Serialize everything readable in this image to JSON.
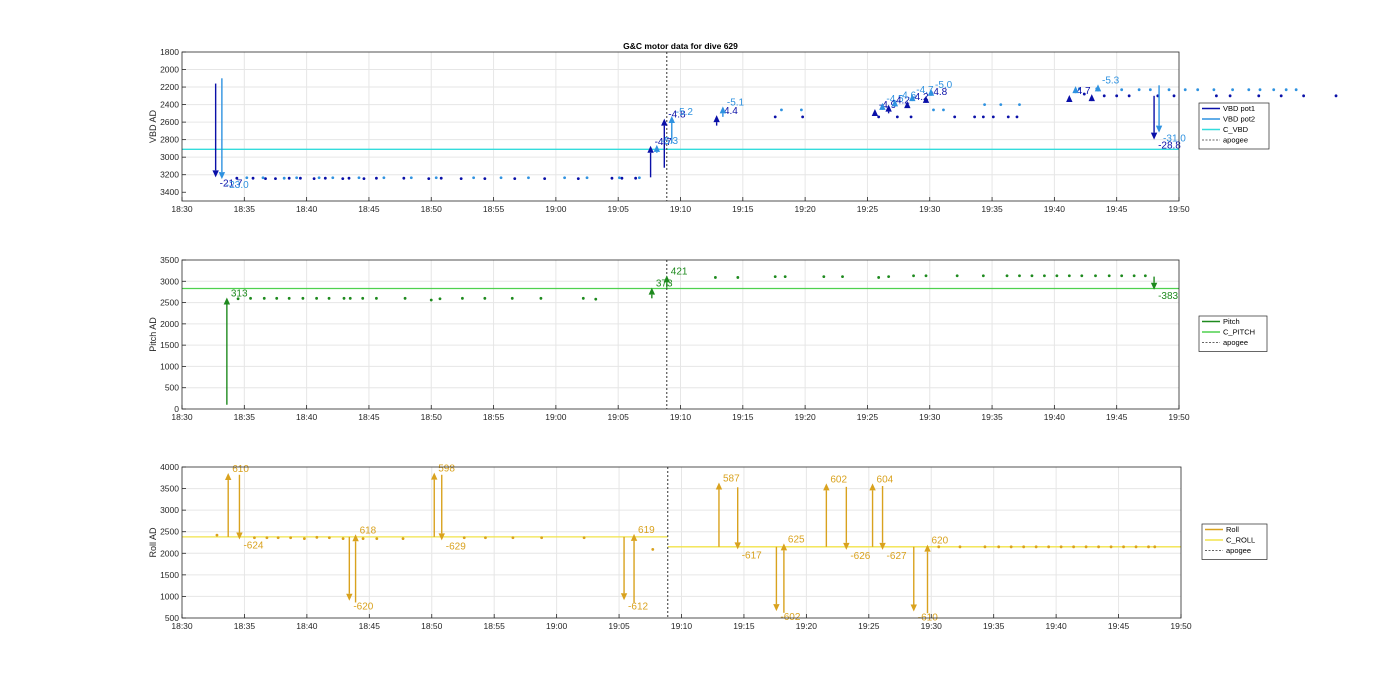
{
  "title": "G&C motor data for dive 629",
  "x_tick_labels": [
    "18:30",
    "18:35",
    "18:40",
    "18:45",
    "18:50",
    "18:55",
    "19:00",
    "19:05",
    "19:10",
    "19:15",
    "19:20",
    "19:25",
    "19:30",
    "19:35",
    "19:40",
    "19:45",
    "19:50"
  ],
  "colors": {
    "vbd_pot1": "#0a10a8",
    "vbd_pot2": "#2f92e0",
    "c_vbd": "#33dcdc",
    "pitch": "#1e8a1e",
    "c_pitch": "#4fd14f",
    "roll": "#d9a21e",
    "c_roll": "#f2e34a",
    "apogee": "#333333",
    "axis": "#262626",
    "grid": "#e6e6e6"
  },
  "chart_data": [
    {
      "type": "scatter",
      "panel": "vbd",
      "title": "G&C motor data for dive 629",
      "xlabel": "",
      "ylabel": "VBD AD",
      "x_unit": "minutes since 18:30",
      "xlim": [
        0,
        80
      ],
      "ylim": [
        1800,
        3500
      ],
      "y_reversed": true,
      "y_ticks": [
        1800,
        2000,
        2200,
        2400,
        2600,
        2800,
        3000,
        3200,
        3400
      ],
      "grid": true,
      "legend": {
        "position": "right",
        "entries": [
          "VBD pot1",
          "VBD pot2",
          "C_VBD",
          "apogee"
        ]
      },
      "reference_line": {
        "name": "C_VBD",
        "value": 2910
      },
      "apogee": 38.9,
      "series": [
        {
          "name": "VBD pot1",
          "style": "dots",
          "x": [
            4.4,
            5.7,
            6.7,
            7.5,
            8.6,
            9.5,
            10.6,
            11.5,
            12.9,
            13.4,
            14.6,
            15.6,
            17.8,
            19.8,
            20.8,
            22.4,
            24.3,
            26.7,
            29.1,
            31.8,
            34.5,
            35.3,
            36.4,
            47.6,
            49.8,
            55.9,
            57.4,
            58.5,
            62,
            63.6,
            64.3,
            65.1,
            66.3,
            67,
            72.4,
            74,
            75,
            76,
            78.3,
            79.6,
            83,
            84.1,
            86.4,
            88.2,
            90,
            92.6
          ],
          "y": [
            3240,
            3240,
            3245,
            3245,
            3240,
            3240,
            3245,
            3240,
            3245,
            3240,
            3245,
            3240,
            3240,
            3245,
            3240,
            3245,
            3245,
            3245,
            3245,
            3245,
            3240,
            3240,
            3240,
            2540,
            2540,
            2540,
            2540,
            2540,
            2540,
            2540,
            2540,
            2540,
            2540,
            2540,
            2280,
            2300,
            2300,
            2300,
            2300,
            2300,
            2300,
            2300,
            2300,
            2300,
            2300,
            2300
          ]
        },
        {
          "name": "VBD pot2",
          "style": "dots",
          "x": [
            5.2,
            6.5,
            8.2,
            9.2,
            11,
            12.1,
            14.2,
            16.2,
            18.4,
            20.4,
            23.4,
            25.6,
            27.8,
            30.7,
            32.5,
            35.1,
            36.7,
            48.1,
            49.7,
            60.3,
            61.1,
            64.4,
            65.7,
            67.2,
            72,
            73.4,
            75.4,
            76.8,
            77.7,
            79.2,
            80.5,
            81.5,
            82.8,
            84.3,
            85.6,
            86.5,
            87.6,
            88.6,
            89.4
          ],
          "y": [
            3235,
            3235,
            3240,
            3235,
            3235,
            3235,
            3235,
            3235,
            3235,
            3235,
            3235,
            3235,
            3235,
            3235,
            3235,
            3235,
            3235,
            2460,
            2460,
            2460,
            2460,
            2400,
            2400,
            2400,
            2220,
            2220,
            2230,
            2230,
            2230,
            2230,
            2230,
            2230,
            2230,
            2230,
            2230,
            2230,
            2230,
            2230,
            2230
          ]
        }
      ],
      "arrows": [
        {
          "series": "VBD pot1",
          "x": 2.7,
          "from": 2160,
          "to": 3230,
          "label": "-21.7"
        },
        {
          "series": "VBD pot2",
          "x": 3.2,
          "from": 2100,
          "to": 3250,
          "label": "-23.0"
        },
        {
          "series": "VBD pot1",
          "x": 37.6,
          "from": 3230,
          "to": 2870,
          "label": "-4.7"
        },
        {
          "series": "VBD pot1",
          "x": 38.7,
          "from": 3120,
          "to": 2560,
          "label": "-4.8"
        },
        {
          "series": "VBD pot2",
          "x": 38.1,
          "from": 2950,
          "to": 2860,
          "label": "-5.3"
        },
        {
          "series": "VBD pot2",
          "x": 39.3,
          "from": 2840,
          "to": 2530,
          "label": "-5.2"
        },
        {
          "series": "VBD pot1",
          "x": 42.9,
          "from": 2640,
          "to": 2520,
          "label": "-4.4"
        },
        {
          "series": "VBD pot2",
          "x": 43.4,
          "from": 2540,
          "to": 2420,
          "label": "-5.1"
        },
        {
          "series": "VBD pot1",
          "x": 55.6,
          "from": 2530,
          "to": 2450,
          "label": "-4.9"
        },
        {
          "series": "VBD pot2",
          "x": 56.2,
          "from": 2440,
          "to": 2380,
          "label": "-4.5"
        },
        {
          "series": "VBD pot1",
          "x": 56.7,
          "from": 2500,
          "to": 2400,
          "label": "-4.2"
        },
        {
          "series": "VBD pot2",
          "x": 57.2,
          "from": 2400,
          "to": 2340,
          "label": "-4.6"
        },
        {
          "series": "VBD pot1",
          "x": 58.2,
          "from": 2440,
          "to": 2360,
          "label": "-4.2"
        },
        {
          "series": "VBD pot2",
          "x": 58.6,
          "from": 2340,
          "to": 2280,
          "label": "-4.7"
        },
        {
          "series": "VBD pot1",
          "x": 59.7,
          "from": 2370,
          "to": 2300,
          "label": "-4.8"
        },
        {
          "series": "VBD pot2",
          "x": 60.1,
          "from": 2280,
          "to": 2220,
          "label": "-5.0"
        },
        {
          "series": "VBD pot1",
          "x": 71.2,
          "from": 2360,
          "to": 2290,
          "label": "-4.7"
        },
        {
          "series": "VBD pot2",
          "x": 71.7,
          "from": 2250,
          "to": 2190,
          "label": ""
        },
        {
          "series": "VBD pot1",
          "x": 73,
          "from": 2340,
          "to": 2280,
          "label": ""
        },
        {
          "series": "VBD pot2",
          "x": 73.5,
          "from": 2230,
          "to": 2170,
          "label": "-5.3"
        },
        {
          "series": "VBD pot1",
          "x": 78,
          "from": 2300,
          "to": 2800,
          "label": "-28.8"
        },
        {
          "series": "VBD pot2",
          "x": 78.4,
          "from": 2180,
          "to": 2720,
          "label": "-31.0"
        }
      ]
    },
    {
      "type": "scatter",
      "panel": "pitch",
      "xlabel": "",
      "ylabel": "Pitch AD",
      "x_unit": "minutes since 18:30",
      "xlim": [
        0,
        80
      ],
      "ylim": [
        0,
        3500
      ],
      "y_ticks": [
        0,
        500,
        1000,
        1500,
        2000,
        2500,
        3000,
        3500
      ],
      "grid": true,
      "legend": {
        "position": "right",
        "entries": [
          "Pitch",
          "C_PITCH",
          "apogee"
        ]
      },
      "reference_line": {
        "name": "C_PITCH",
        "value": 2830
      },
      "apogee": 38.9,
      "series": [
        {
          "name": "Pitch",
          "style": "dots",
          "x": [
            4.5,
            5.5,
            6.6,
            7.6,
            8.6,
            9.7,
            10.8,
            11.8,
            13,
            13.5,
            14.5,
            15.6,
            17.9,
            20,
            20.7,
            22.5,
            24.3,
            26.5,
            28.8,
            32.2,
            33.2,
            42.8,
            44.6,
            47.6,
            48.4,
            51.5,
            53,
            55.9,
            56.7,
            58.7,
            59.7,
            62.2,
            64.3,
            66.2,
            67.2,
            68.2,
            69.2,
            70.2,
            71.2,
            72.2,
            73.3,
            74.4,
            75.4,
            76.4,
            77.3
          ],
          "y": [
            2590,
            2600,
            2600,
            2600,
            2600,
            2600,
            2600,
            2600,
            2600,
            2600,
            2600,
            2600,
            2600,
            2560,
            2590,
            2600,
            2600,
            2600,
            2600,
            2600,
            2580,
            3090,
            3090,
            3110,
            3110,
            3110,
            3110,
            3090,
            3110,
            3130,
            3130,
            3130,
            3130,
            3130,
            3130,
            3130,
            3130,
            3130,
            3130,
            3130,
            3130,
            3130,
            3130,
            3130,
            3130
          ]
        }
      ],
      "arrows": [
        {
          "series": "Pitch",
          "x": 3.6,
          "from": 100,
          "to": 2620,
          "label": "313"
        },
        {
          "series": "Pitch",
          "x": 37.7,
          "from": 2600,
          "to": 2850,
          "label": "373"
        },
        {
          "series": "Pitch",
          "x": 38.9,
          "from": 2850,
          "to": 3140,
          "label": "421"
        },
        {
          "series": "Pitch",
          "x": 78,
          "from": 3110,
          "to": 2800,
          "label": "-383"
        }
      ]
    },
    {
      "type": "scatter",
      "panel": "roll",
      "xlabel": "",
      "ylabel": "Roll AD",
      "x_unit": "minutes since 18:30",
      "xlim": [
        0,
        80
      ],
      "ylim": [
        500,
        4000
      ],
      "y_ticks": [
        500,
        1000,
        1500,
        2000,
        2500,
        3000,
        3500,
        4000
      ],
      "grid": true,
      "legend": {
        "position": "right",
        "entries": [
          "Roll",
          "C_ROLL",
          "apogee"
        ]
      },
      "reference_segments": [
        {
          "name": "C_ROLL",
          "x0": 0,
          "x1": 38.9,
          "value": 2380
        },
        {
          "name": "C_ROLL",
          "x0": 38.9,
          "x1": 80,
          "value": 2150
        }
      ],
      "apogee": 38.9,
      "series": [
        {
          "name": "Roll",
          "style": "dots",
          "x": [
            2.8,
            5.8,
            6.8,
            7.7,
            8.7,
            9.8,
            10.8,
            11.8,
            12.9,
            14.5,
            15.6,
            17.7,
            22.6,
            24.3,
            26.5,
            28.8,
            32.2,
            37.7,
            60.6,
            62.3,
            64.3,
            65.4,
            66.4,
            67.4,
            68.4,
            69.4,
            70.4,
            71.4,
            72.4,
            73.4,
            74.4,
            75.4,
            76.4,
            77.4,
            77.9
          ],
          "y": [
            2420,
            2360,
            2360,
            2360,
            2360,
            2340,
            2370,
            2360,
            2340,
            2340,
            2340,
            2340,
            2360,
            2360,
            2360,
            2360,
            2360,
            2090,
            2150,
            2150,
            2150,
            2150,
            2150,
            2150,
            2150,
            2150,
            2150,
            2150,
            2150,
            2150,
            2150,
            2150,
            2150,
            2150,
            2150
          ]
        }
      ],
      "arrows": [
        {
          "series": "Roll",
          "x": 3.7,
          "from": 2380,
          "to": 3860,
          "label": "610"
        },
        {
          "series": "Roll",
          "x": 4.6,
          "from": 3820,
          "to": 2320,
          "label": "-624"
        },
        {
          "series": "Roll",
          "x": 13.4,
          "from": 2380,
          "to": 900,
          "label": "-620"
        },
        {
          "series": "Roll",
          "x": 13.9,
          "from": 860,
          "to": 2440,
          "label": "618"
        },
        {
          "series": "Roll",
          "x": 20.2,
          "from": 2380,
          "to": 3870,
          "label": "598"
        },
        {
          "series": "Roll",
          "x": 20.8,
          "from": 3820,
          "to": 2300,
          "label": "-629"
        },
        {
          "series": "Roll",
          "x": 35.4,
          "from": 2380,
          "to": 910,
          "label": "-612"
        },
        {
          "series": "Roll",
          "x": 36.2,
          "from": 860,
          "to": 2450,
          "label": "619"
        },
        {
          "series": "Roll",
          "x": 43,
          "from": 2150,
          "to": 3640,
          "label": "587"
        },
        {
          "series": "Roll",
          "x": 44.5,
          "from": 3530,
          "to": 2090,
          "label": "-617"
        },
        {
          "series": "Roll",
          "x": 47.6,
          "from": 2150,
          "to": 660,
          "label": "-602"
        },
        {
          "series": "Roll",
          "x": 48.2,
          "from": 620,
          "to": 2230,
          "label": "625"
        },
        {
          "series": "Roll",
          "x": 51.6,
          "from": 2150,
          "to": 3620,
          "label": "602"
        },
        {
          "series": "Roll",
          "x": 53.2,
          "from": 3540,
          "to": 2080,
          "label": "-626"
        },
        {
          "series": "Roll",
          "x": 55.3,
          "from": 2150,
          "to": 3620,
          "label": "604"
        },
        {
          "series": "Roll",
          "x": 56.1,
          "from": 3560,
          "to": 2080,
          "label": "-627"
        },
        {
          "series": "Roll",
          "x": 58.6,
          "from": 2150,
          "to": 650,
          "label": "-610"
        },
        {
          "series": "Roll",
          "x": 59.7,
          "from": 610,
          "to": 2200,
          "label": "620"
        }
      ]
    }
  ]
}
